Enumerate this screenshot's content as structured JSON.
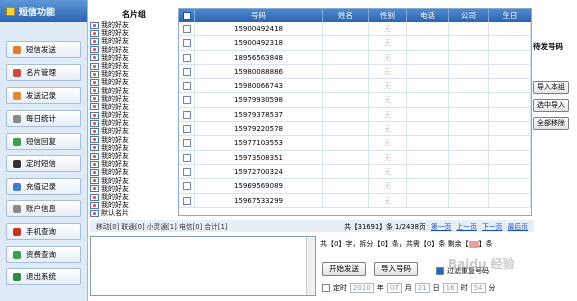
{
  "nav": {
    "title": "短信功能",
    "items": [
      {
        "label": "短信发送",
        "icon": "send-sms-icon",
        "color": "#e07b2b"
      },
      {
        "label": "名片管理",
        "icon": "card-icon",
        "color": "#d14a3a"
      },
      {
        "label": "发送记录",
        "icon": "send-record-icon",
        "color": "#e08a2a"
      },
      {
        "label": "每日统计",
        "icon": "daily-stats-icon",
        "color": "#8a8a8a"
      },
      {
        "label": "短信回复",
        "icon": "reply-icon",
        "color": "#3f9e4a"
      },
      {
        "label": "定时短信",
        "icon": "clock-icon",
        "color": "#333333"
      },
      {
        "label": "充值记录",
        "icon": "recharge-icon",
        "color": "#3f7fd0"
      },
      {
        "label": "账户信息",
        "icon": "account-icon",
        "color": "#8a8a8a"
      },
      {
        "label": "手机查询",
        "icon": "phone-icon",
        "color": "#c8321e"
      },
      {
        "label": "资费查询",
        "icon": "fee-icon",
        "color": "#3f9e4a"
      },
      {
        "label": "退出系统",
        "icon": "exit-icon",
        "color": "#2e8a3e"
      }
    ]
  },
  "groups": {
    "title": "名片组",
    "items": [
      "我的好友",
      "我的好友",
      "我的好友",
      "我的好友",
      "我的好友",
      "我的好友",
      "我的好友",
      "我的好友",
      "我的好友",
      "我的好友",
      "我的好友",
      "我的好友",
      "我的好友",
      "我的好友",
      "我的好友",
      "我的好友",
      "我的好友",
      "我的好友",
      "我的好友",
      "我的好友",
      "我的好友",
      "我的好友",
      "我的好友",
      "默认名片"
    ]
  },
  "table": {
    "columns": [
      "号码",
      "姓名",
      "性别",
      "电话",
      "公司",
      "生日"
    ],
    "rows": [
      {
        "phone": "15900492418",
        "gender": "无"
      },
      {
        "phone": "15900492318",
        "gender": "无"
      },
      {
        "phone": "18956563848",
        "gender": "无"
      },
      {
        "phone": "15980088886",
        "gender": "无"
      },
      {
        "phone": "15980066743",
        "gender": "无"
      },
      {
        "phone": "15979930598",
        "gender": "无"
      },
      {
        "phone": "15979378537",
        "gender": "无"
      },
      {
        "phone": "15979220578",
        "gender": "无"
      },
      {
        "phone": "15977103553",
        "gender": "无"
      },
      {
        "phone": "15973508351",
        "gender": "无"
      },
      {
        "phone": "15972700324",
        "gender": "无"
      },
      {
        "phone": "15969569089",
        "gender": "无"
      },
      {
        "phone": "15967533299",
        "gender": "无"
      }
    ]
  },
  "right_panel": {
    "title": "待发号码",
    "import_group": "导入本组",
    "import_selected": "选中导入",
    "remove_all": "全部移除"
  },
  "status": {
    "stats": "移动[0]  联通[0]  小灵通[1]  电信[0]  合计[1]",
    "total": "共【31691】条 1/2438页",
    "first": "第一页",
    "prev": "上一页",
    "next": "下一页",
    "last": "最后页"
  },
  "send": {
    "info_prefix": "共【0】字，拆分【0】条，共需【0】条  剩余【",
    "info_suffix": "】条",
    "start": "开始发送",
    "import_numbers": "导入号码",
    "filter_dup": "过滤重复号码",
    "timed": "定时",
    "year": "2010",
    "month": "07",
    "day": "21",
    "hour": "16",
    "minute": "54",
    "year_unit": "年",
    "month_unit": "月",
    "day_unit": "日",
    "hour_unit": "时",
    "minute_unit": "分"
  },
  "watermark": "Baidu 经验"
}
